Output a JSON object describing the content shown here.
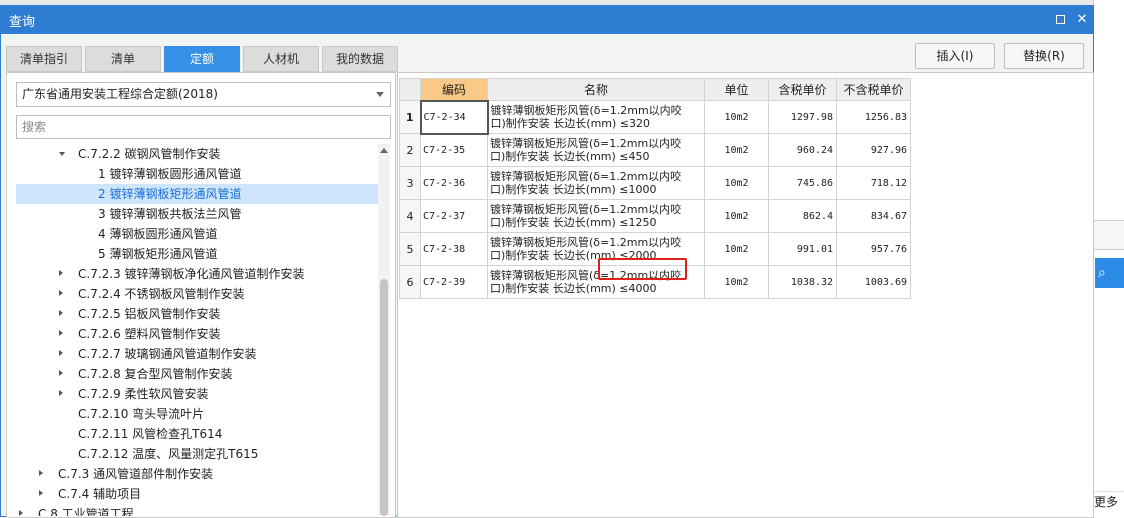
{
  "dialog": {
    "title": "查询",
    "tabs": [
      "清单指引",
      "清单",
      "定额",
      "人材机",
      "我的数据"
    ],
    "active_tab": "定额",
    "insert_label": "插入(I)",
    "replace_label": "替换(R)"
  },
  "left": {
    "quota_library": "广东省通用安装工程综合定额(2018)",
    "search_placeholder": "搜索",
    "tree": [
      {
        "label": "C.7.2.2 碳钢风管制作安装",
        "expand": "down"
      },
      {
        "label": "1 镀锌薄钢板圆形通风管道",
        "expand": ""
      },
      {
        "label": "2 镀锌薄钢板矩形通风管道",
        "expand": "",
        "selected": true
      },
      {
        "label": "3 镀锌薄钢板共板法兰风管",
        "expand": ""
      },
      {
        "label": "4 薄钢板圆形通风管道",
        "expand": ""
      },
      {
        "label": "5 薄钢板矩形通风管道",
        "expand": ""
      },
      {
        "label": "C.7.2.3 镀锌薄钢板净化通风管道制作安装",
        "expand": "right"
      },
      {
        "label": "C.7.2.4 不锈钢板风管制作安装",
        "expand": "right"
      },
      {
        "label": "C.7.2.5 铝板风管制作安装",
        "expand": "right"
      },
      {
        "label": "C.7.2.6 塑料风管制作安装",
        "expand": "right"
      },
      {
        "label": "C.7.2.7 玻璃钢通风管道制作安装",
        "expand": "right"
      },
      {
        "label": "C.7.2.8 复合型风管制作安装",
        "expand": "right"
      },
      {
        "label": "C.7.2.9 柔性软风管安装",
        "expand": "right"
      },
      {
        "label": "C.7.2.10 弯头导流叶片",
        "expand": ""
      },
      {
        "label": "C.7.2.11 风管检查孔T614",
        "expand": ""
      },
      {
        "label": "C.7.2.12 温度、风量测定孔T615",
        "expand": ""
      },
      {
        "label": "C.7.3 通风管道部件制作安装",
        "expand": "right"
      },
      {
        "label": "C.7.4 辅助项目",
        "expand": "right"
      },
      {
        "label": "C.8 工业管道工程",
        "expand": "right"
      }
    ]
  },
  "grid": {
    "headers": [
      "编码",
      "名称",
      "单位",
      "含税单价",
      "不含税单价"
    ],
    "rows": [
      {
        "n": "1",
        "code": "C7-2-34",
        "name1": "镀锌薄钢板矩形风管(δ=1.2mm以内咬",
        "name2": "口)制作安装 长边长(mm) ≤320",
        "unit": "10m2",
        "tax": "1297.98",
        "notax": "1256.83"
      },
      {
        "n": "2",
        "code": "C7-2-35",
        "name1": "镀锌薄钢板矩形风管(δ=1.2mm以内咬",
        "name2": "口)制作安装 长边长(mm) ≤450",
        "unit": "10m2",
        "tax": "960.24",
        "notax": "927.96"
      },
      {
        "n": "3",
        "code": "C7-2-36",
        "name1": "镀锌薄钢板矩形风管(δ=1.2mm以内咬",
        "name2": "口)制作安装 长边长(mm) ≤1000",
        "unit": "10m2",
        "tax": "745.86",
        "notax": "718.12"
      },
      {
        "n": "4",
        "code": "C7-2-37",
        "name1": "镀锌薄钢板矩形风管(δ=1.2mm以内咬",
        "name2": "口)制作安装 长边长(mm) ≤1250",
        "unit": "10m2",
        "tax": "862.4",
        "notax": "834.67"
      },
      {
        "n": "5",
        "code": "C7-2-38",
        "name1": "镀锌薄钢板矩形风管(δ=1.2mm以内咬",
        "name2": "口)制作安装 长边长(mm) ≤2000",
        "unit": "10m2",
        "tax": "991.01",
        "notax": "957.76"
      },
      {
        "n": "6",
        "code": "C7-2-39",
        "name1": "镀锌薄钢板矩形风管(δ=1.2mm以内咬",
        "name2": "口)制作安装 长边长(mm) ≤4000",
        "unit": "10m2",
        "tax": "1038.32",
        "notax": "1003.69"
      }
    ]
  },
  "background": {
    "more_label": "更多"
  },
  "colors": {
    "title_bar": "#2f7dd3",
    "active_tab": "#3590e6",
    "code_header": "#f8c987",
    "selection": "#cfe5fb",
    "highlight_box": "#e0201a"
  }
}
